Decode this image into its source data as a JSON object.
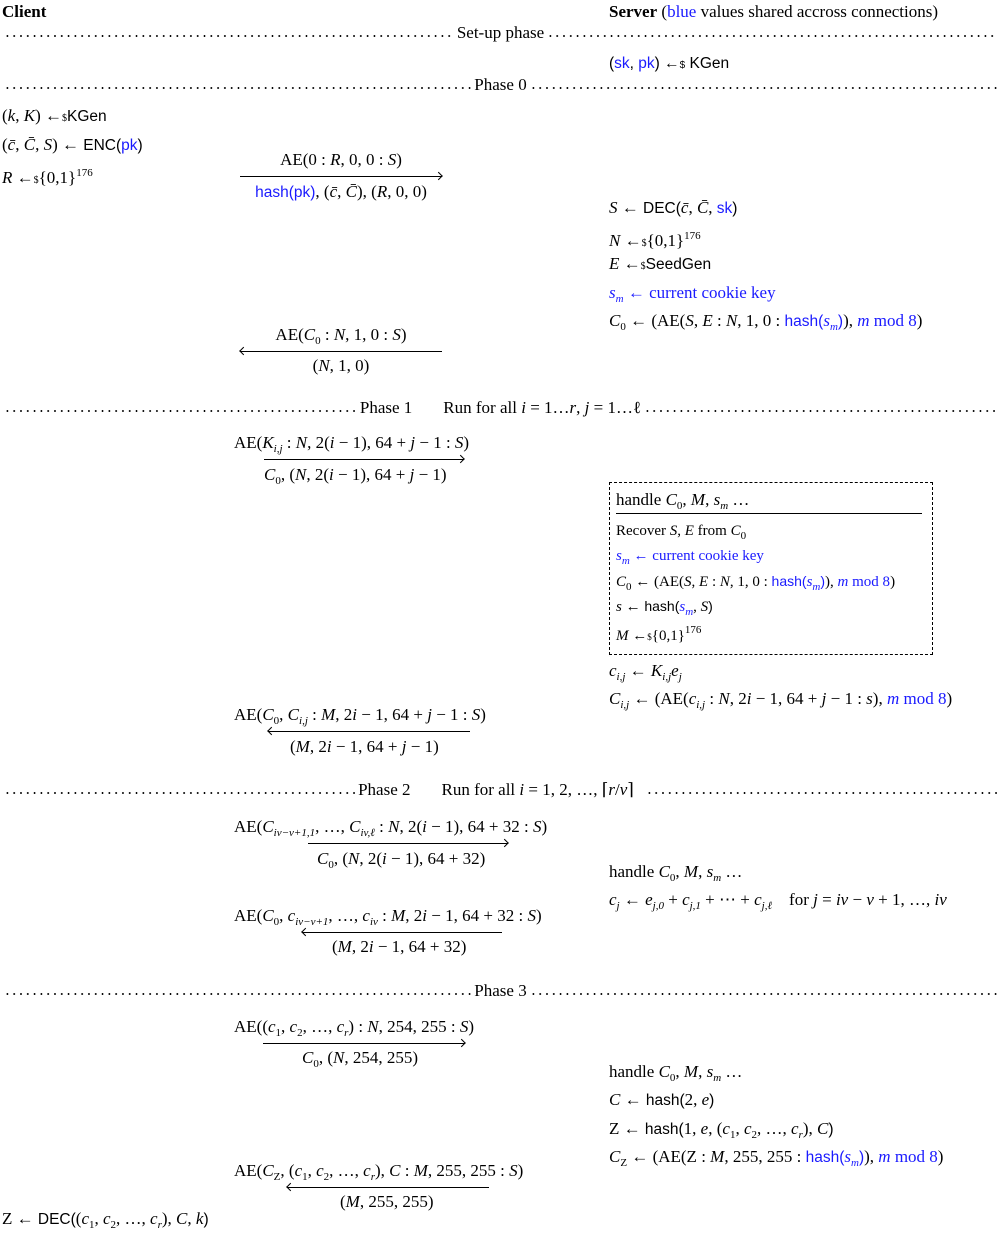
{
  "header": {
    "client_title": "Client",
    "server_title": "Server",
    "server_note_open": "(",
    "server_note_blue": "blue",
    "server_note_rest": " values shared accross connections)"
  },
  "colors": {
    "shared_value_blue": "#1a1aff",
    "text": "#000000",
    "background": "#ffffff"
  },
  "phases": {
    "setup": {
      "label": "Set-up phase"
    },
    "phase0": {
      "label": "Phase 0"
    },
    "phase1": {
      "label": "Phase 1",
      "note": "Run for all i = 1…r, j = 1…ℓ"
    },
    "phase2": {
      "label": "Phase 2",
      "note": "Run for all i = 1, 2, …, ⌈r/v⌉"
    },
    "phase3": {
      "label": "Phase 3"
    }
  },
  "setup": {
    "server_keygen": "(sk, pk) ←$ KGen"
  },
  "phase0": {
    "client_steps": [
      "(k, K) ←$ KGen",
      "(c̄, C̄, S) ← ENC(pk)",
      "R ←$ {0,1}^176"
    ],
    "msg1": {
      "direction": "client-to-server",
      "top": "AE(0 : R, 0, 0 : S)",
      "bottom_blue": "hash(pk)",
      "bottom_rest": ", (c̄, C̄), (R, 0, 0)"
    },
    "server_steps": [
      "S ← DEC(c̄, C̄, sk)",
      "N ←$ {0,1}^176",
      "E ←$ SeedGen",
      "s_m ← current cookie key",
      "C0 ← (AE(S, E : N, 1, 0 : hash(s_m)), m mod 8)"
    ],
    "msg2": {
      "direction": "server-to-client",
      "top": "AE(C0 : N, 1, 0 : S)",
      "bottom": "(N, 1, 0)"
    }
  },
  "phase1": {
    "msg1": {
      "direction": "client-to-server",
      "top": "AE(K_{i,j} : N, 2(i−1), 64+j−1 : S)",
      "bottom": "C0, (N, 2(i−1), 64+j−1)"
    },
    "handle_box": {
      "title": "handle C0, M, s_m …",
      "lines": [
        "Recover S, E from C0",
        "s_m ← current cookie key",
        "C0 ← (AE(S, E : N, 1, 0 : hash(s_m)), m mod 8)",
        "s ← hash(s_m, S)",
        "M ←$ {0,1}^176"
      ]
    },
    "server_steps": [
      "c_{i,j} ← K_{i,j} e_j",
      "C_{i,j} ← (AE(c_{i,j} : N, 2i−1, 64+j−1 : s), m mod 8)"
    ],
    "msg2": {
      "direction": "server-to-client",
      "top": "AE(C0, C_{i,j} : M, 2i−1, 64+j−1 : S)",
      "bottom": "(M, 2i−1, 64+j−1)"
    }
  },
  "phase2": {
    "msg1": {
      "direction": "client-to-server",
      "top": "AE(C_{iv−v+1,1}, …, C_{iv,ℓ} : N, 2(i−1), 64+32 : S)",
      "bottom": "C0, (N, 2(i−1), 64+32)"
    },
    "server_steps": [
      "handle C0, M, s_m …",
      "c_j ← e_{j,0} + c_{j,1} + ⋯ + c_{j,ℓ}    for j = iv−v+1, …, iv"
    ],
    "msg2": {
      "direction": "server-to-client",
      "top": "AE(C0, c_{iv−v+1}, …, c_{iv} : M, 2i−1, 64+32 : S)",
      "bottom": "(M, 2i−1, 64+32)"
    }
  },
  "phase3": {
    "msg1": {
      "direction": "client-to-server",
      "top": "AE((c1, c2, …, cr) : N, 254, 255 : S)",
      "bottom": "C0, (N, 254, 255)"
    },
    "server_steps": [
      "handle C0, M, s_m …",
      "C ← hash(2, e)",
      "Z ← hash(1, e, (c1, c2, …, cr), C)",
      "C_Z ← (AE(Z : M, 255, 255 : hash(s_m)), m mod 8)"
    ],
    "msg2": {
      "direction": "server-to-client",
      "top": "AE(C_Z, (c1, c2, …, cr), C : M, 255, 255 : S)",
      "bottom": "(M, 255, 255)"
    },
    "client_final": "Z ← DEC((c1, c2, …, cr), C, k)"
  }
}
